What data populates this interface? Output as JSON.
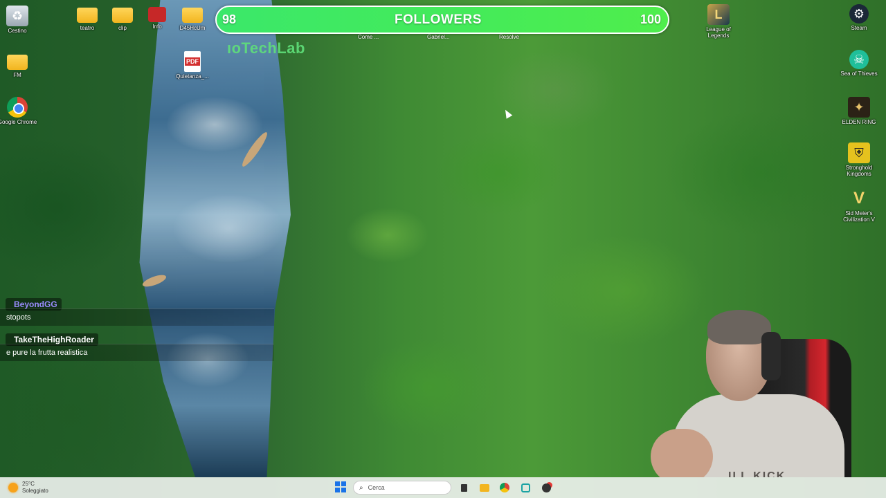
{
  "desktop": {
    "left_icons": [
      {
        "label": "Cestino",
        "icon": "recycle-bin-icon"
      },
      {
        "label": "FM",
        "icon": "folder-icon"
      },
      {
        "label": "Google Chrome",
        "icon": "chrome-icon"
      }
    ],
    "top_icons": [
      {
        "label": "teatro",
        "icon": "folder-icon"
      },
      {
        "label": "clip",
        "icon": "folder-icon"
      },
      {
        "label": "Info",
        "icon": "app-icon"
      },
      {
        "label": "D45HcUm",
        "icon": "folder-icon"
      },
      {
        "label": "Quietanza_...",
        "icon": "pdf-icon"
      }
    ],
    "partial_labels": [
      "Come ...",
      "Gabriel...",
      "Resolve"
    ],
    "right_icons": [
      {
        "label": "League of Legends",
        "icon": "league-icon"
      },
      {
        "label": "Steam",
        "icon": "steam-icon"
      },
      {
        "label": "Sea of Thieves",
        "icon": "sea-of-thieves-icon"
      },
      {
        "label": "ELDEN RING",
        "icon": "elden-ring-icon"
      },
      {
        "label": "Stronghold Kingdoms",
        "icon": "stronghold-icon"
      },
      {
        "label": "Sid Meier's Civilization V",
        "icon": "civilization-icon"
      }
    ]
  },
  "overlay": {
    "followers": {
      "current": "98",
      "title": "FOLLOWERS",
      "goal": "100",
      "progress": 0.98
    },
    "watermark": "ıoTechLab",
    "chat": [
      {
        "user": "BeyondGG",
        "user_color": "#9b8cff",
        "message": "stopots"
      },
      {
        "user": "TakeTheHighRoader",
        "user_color": "#ffffff",
        "message": "e pure la frutta realistica"
      }
    ],
    "webcam_shirt_text": "ILL KICK"
  },
  "taskbar": {
    "weather_temp": "25°C",
    "weather_desc": "Soleggiato",
    "search_placeholder": "Cerca",
    "apps": [
      "task-view-icon",
      "file-explorer-icon",
      "chrome-icon",
      "app-icon",
      "obs-icon"
    ]
  },
  "pdf_badge": "PDF"
}
